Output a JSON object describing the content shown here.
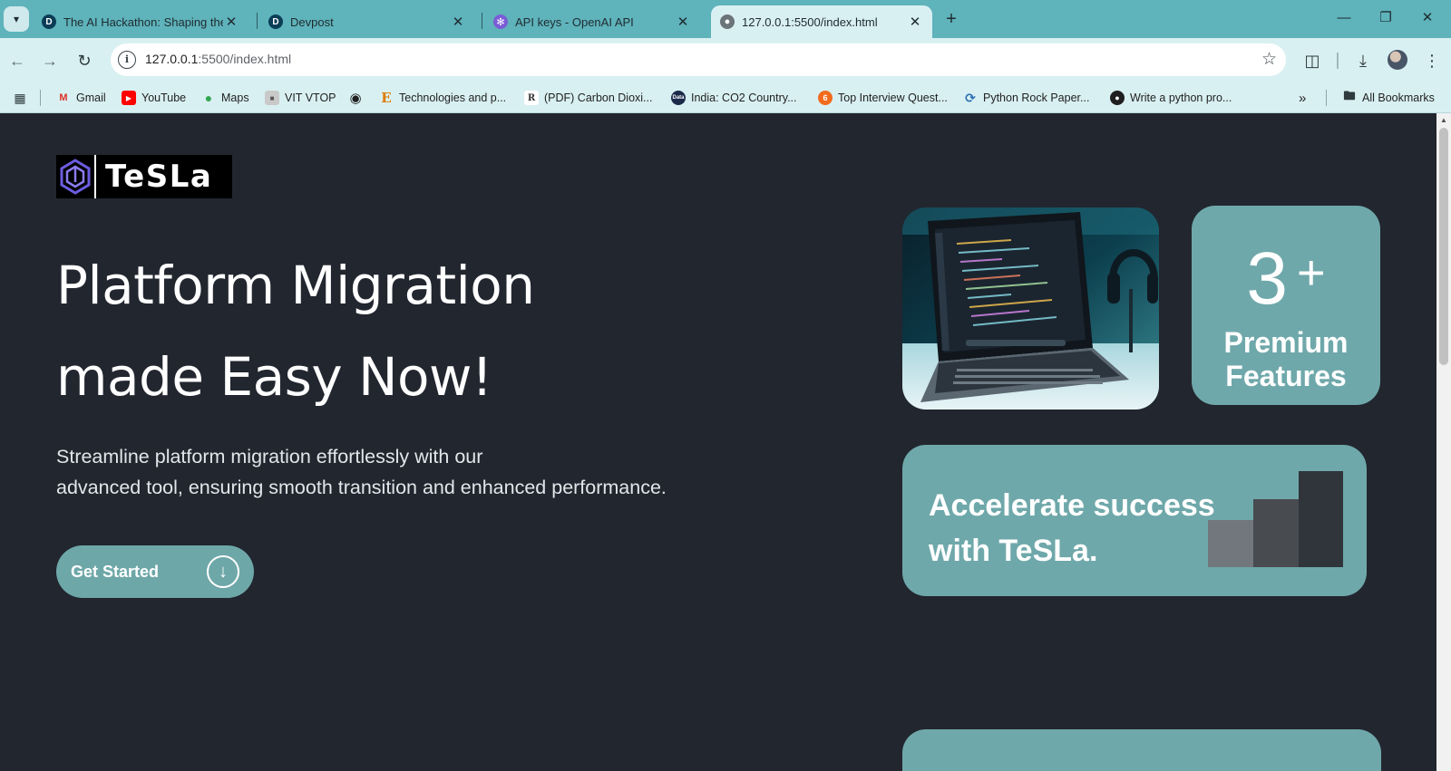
{
  "browser": {
    "tabs": [
      {
        "title": "The AI Hackathon: Shaping the",
        "favicon": "devpost-icon"
      },
      {
        "title": "Devpost",
        "favicon": "devpost-icon"
      },
      {
        "title": "API keys - OpenAI API",
        "favicon": "openai-icon"
      },
      {
        "title": "127.0.0.1:5500/index.html",
        "favicon": "globe-icon",
        "active": true
      }
    ],
    "url_host": "127.0.0.1",
    "url_path": ":5500/index.html",
    "bookmarks": [
      {
        "label": "Gmail",
        "icon": "gmail-icon"
      },
      {
        "label": "YouTube",
        "icon": "youtube-icon"
      },
      {
        "label": "Maps",
        "icon": "maps-icon"
      },
      {
        "label": "VIT VTOP",
        "icon": "vtop-icon"
      },
      {
        "label": "",
        "icon": "globe-icon"
      },
      {
        "label": "Technologies and p...",
        "icon": "e-icon"
      },
      {
        "label": "(PDF) Carbon Dioxi...",
        "icon": "researchgate-icon"
      },
      {
        "label": "India: CO2 Country...",
        "icon": "data-icon"
      },
      {
        "label": "Top Interview Quest...",
        "icon": "leetcode-icon"
      },
      {
        "label": "Python Rock Paper...",
        "icon": "python-icon"
      },
      {
        "label": "Write a python pro...",
        "icon": "github-icon"
      }
    ],
    "all_bookmarks": "All Bookmarks"
  },
  "page": {
    "logo_text": "TeSLa",
    "hero_line1": "Platform Migration",
    "hero_line2": "made Easy Now!",
    "subtitle_line1": "Streamline platform migration effortlessly with our",
    "subtitle_line2": "advanced tool, ensuring smooth transition and enhanced performance.",
    "cta_label": "Get Started",
    "stat_number": "3",
    "stat_plus": "+",
    "stat_label_line1": "Premium",
    "stat_label_line2": "Features",
    "accel_line1": "Accelerate success",
    "accel_line2": "with TeSLa."
  },
  "colors": {
    "page_bg": "#22262f",
    "accent_teal": "#6fa8aa",
    "chrome_tab_bar": "#5fb3bb",
    "chrome_toolbar": "#d9f0f2"
  }
}
